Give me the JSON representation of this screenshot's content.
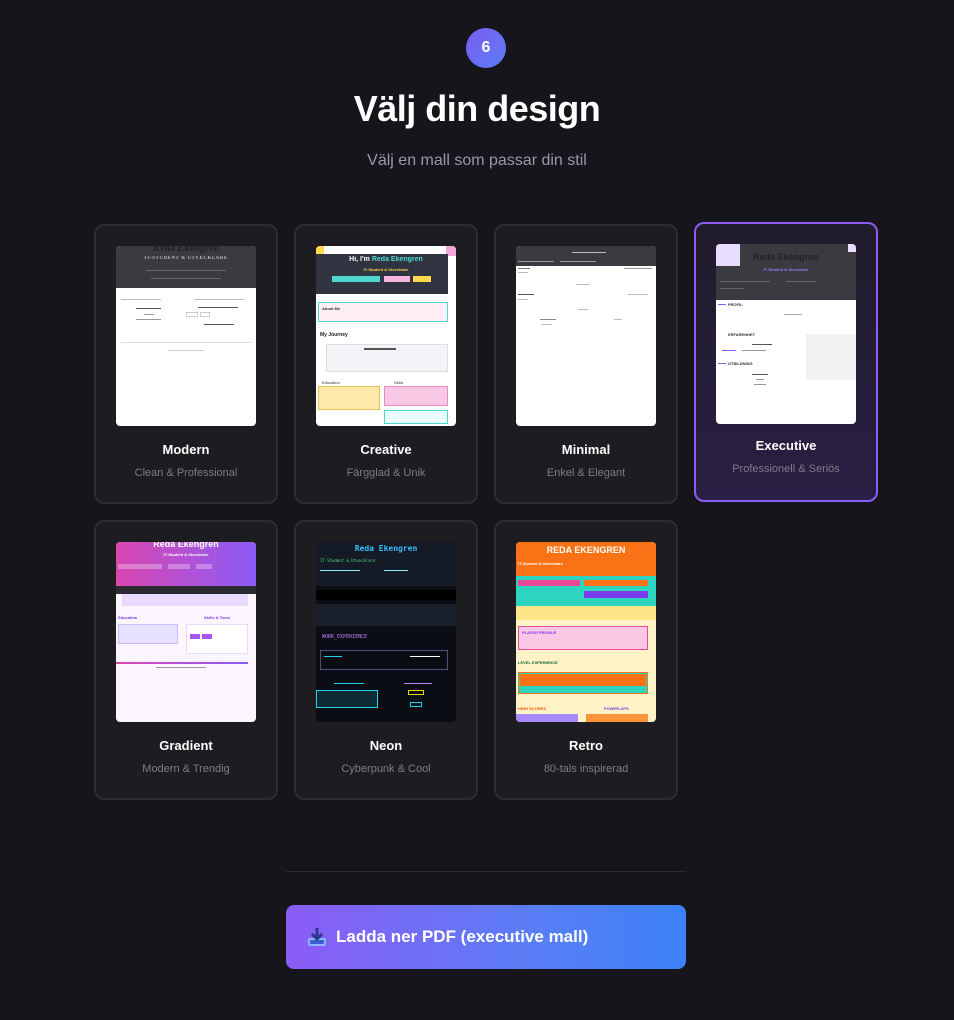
{
  "step": {
    "number": "6"
  },
  "header": {
    "title": "Välj din design",
    "subtitle": "Välj en mall som passar din stil"
  },
  "templates": [
    {
      "id": "modern",
      "name": "Modern",
      "description": "Clean & Professional",
      "selected": false
    },
    {
      "id": "creative",
      "name": "Creative",
      "description": "Färgglad & Unik",
      "selected": false
    },
    {
      "id": "minimal",
      "name": "Minimal",
      "description": "Enkel & Elegant",
      "selected": false
    },
    {
      "id": "executive",
      "name": "Executive",
      "description": "Professionell & Seriös",
      "selected": true
    },
    {
      "id": "gradient",
      "name": "Gradient",
      "description": "Modern & Trendig",
      "selected": false
    },
    {
      "id": "neon",
      "name": "Neon",
      "description": "Cyberpunk & Cool",
      "selected": false
    },
    {
      "id": "retro",
      "name": "Retro",
      "description": "80-tals inspirerad",
      "selected": false
    }
  ],
  "previews": {
    "person_name": "Reda Ekengren",
    "person_name_upper": "REDA EKENGREN",
    "person_title": "IT-Student & Utvecklare",
    "person_title_upper": "IT-STUDENT & UTVECKLARE",
    "creative_greeting": "Hi, I'm",
    "creative_about": "About Me",
    "creative_journey": "My Journey",
    "creative_education": "Education",
    "creative_skills": "Skills",
    "exec_profile": "PROFIL",
    "exec_experience": "ERFARENHET",
    "exec_education": "UTBILDNING",
    "gradient_education": "Education",
    "gradient_skills": "Skills & Tools",
    "neon_work": "WORK_EXPERIENCE",
    "retro_profile": "PLAYER PROFILE",
    "retro_level": "LEVEL EXPERIENCE",
    "retro_scores": "HIGH SCORES",
    "retro_powerups": "POWER-UPS"
  },
  "actions": {
    "download_label": "Ladda ner PDF (executive mall)"
  },
  "colors": {
    "background": "#16151b",
    "accent": "#8b5cf6",
    "button_gradient_start": "#8b5cf6",
    "button_gradient_end": "#3b82f6"
  }
}
